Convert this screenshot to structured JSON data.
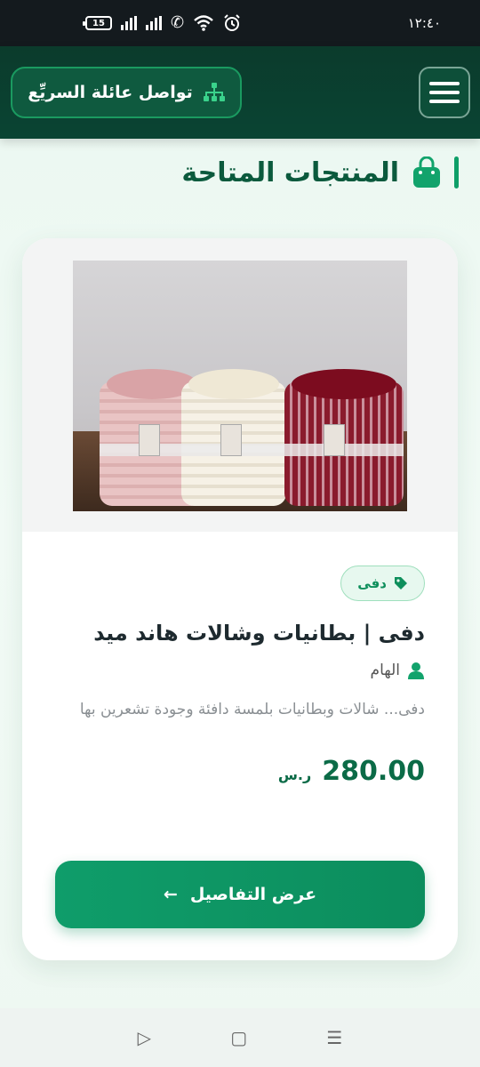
{
  "status_bar": {
    "battery": "15",
    "clock": "١٢:٤٠"
  },
  "header": {
    "brand_label": "تواصل عائلة السريِّع",
    "brand_icon": "sitemap-icon",
    "menu_icon": "hamburger-menu-icon"
  },
  "section": {
    "title": "المنتجات المتاحة",
    "icon": "shopping-bag-icon"
  },
  "product": {
    "category": "دفى",
    "title": "دفى | بطانيات وشالات هاند ميد",
    "seller": "الهام",
    "description": "دفى... شالات وبطانيات بلمسة دافئة وجودة تشعرين بها",
    "price": "280.00",
    "currency": "ر.س",
    "button_label": "عرض التفاصيل",
    "button_arrow": "←"
  },
  "nav": {
    "back": "▷",
    "home": "▢",
    "recents": "☰"
  },
  "colors": {
    "brand_dark": "#0b3b2c",
    "accent_green": "#0f9d6a",
    "title_green": "#0b5a3d"
  }
}
